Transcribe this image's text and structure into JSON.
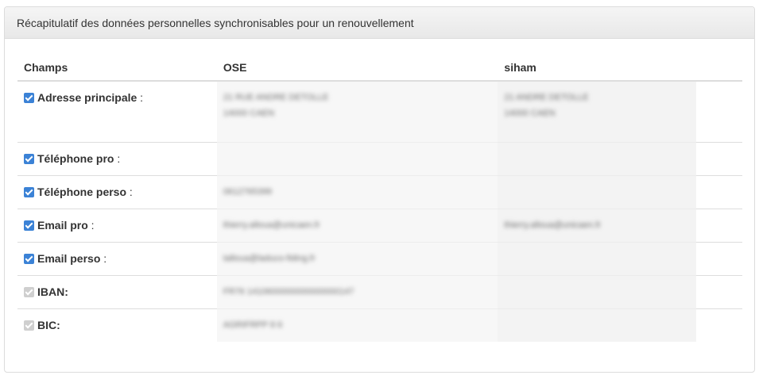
{
  "panel": {
    "heading": "Récapitulatif des données personnelles synchronisables pour un renouvellement"
  },
  "table": {
    "headers": {
      "champs": "Champs",
      "ose": "OSE",
      "siham": "siham"
    },
    "rows": [
      {
        "label": "Adresse principale",
        "suffix": " :",
        "checked": true,
        "disabled": false,
        "ose": [
          "21 RUE ANDRE DETOLLE",
          "14000 CAEN"
        ],
        "siham": [
          "21 ANDRE DETOLLE",
          "14000 CAEN"
        ]
      },
      {
        "label": "Téléphone pro",
        "suffix": " :",
        "checked": true,
        "disabled": false,
        "ose": [],
        "siham": []
      },
      {
        "label": "Téléphone perso",
        "suffix": " :",
        "checked": true,
        "disabled": false,
        "ose": [
          "0612765399"
        ],
        "siham": []
      },
      {
        "label": "Email pro",
        "suffix": " :",
        "checked": true,
        "disabled": false,
        "ose": [
          "thierry.alloua@unicaen.fr"
        ],
        "siham": [
          "thierry.alloua@unicaen.fr"
        ]
      },
      {
        "label": "Email perso",
        "suffix": " :",
        "checked": true,
        "disabled": false,
        "ose": [
          "talloua@laduco-fiding.fr"
        ],
        "siham": []
      },
      {
        "label": "IBAN:",
        "suffix": "",
        "checked": true,
        "disabled": true,
        "ose": [
          "FR76 1410600000000000000147"
        ],
        "siham": []
      },
      {
        "label": "BIC:",
        "suffix": "",
        "checked": true,
        "disabled": true,
        "ose": [
          "AGRIFRPP 8 6"
        ],
        "siham": []
      }
    ]
  },
  "colors": {
    "checkbox": "#3b82d6",
    "checkbox_disabled": "#cfcfcf",
    "header_border": "#dddddd"
  }
}
